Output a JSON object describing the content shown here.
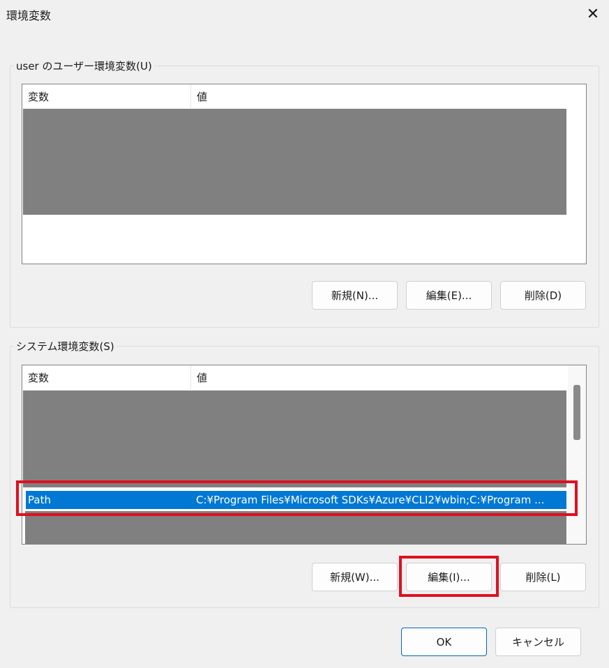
{
  "window": {
    "title": "環境変数",
    "close_symbol": "✕"
  },
  "user_group": {
    "label": "user のユーザー環境変数(U)",
    "columns": [
      "変数",
      "値"
    ],
    "buttons": {
      "new": "新規(N)...",
      "edit": "編集(E)...",
      "delete": "削除(D)"
    }
  },
  "system_group": {
    "label": "システム環境変数(S)",
    "columns": [
      "変数",
      "値"
    ],
    "selected_row": {
      "variable": "Path",
      "value": "C:¥Program Files¥Microsoft SDKs¥Azure¥CLI2¥wbin;C:¥Program ..."
    },
    "buttons": {
      "new": "新規(W)...",
      "edit": "編集(I)...",
      "delete": "削除(L)"
    }
  },
  "footer": {
    "ok": "OK",
    "cancel": "キャンセル"
  },
  "colors": {
    "selection": "#0078d4",
    "redaction": "#808080",
    "highlight": "#e01020",
    "primary_border": "#0067c0"
  }
}
